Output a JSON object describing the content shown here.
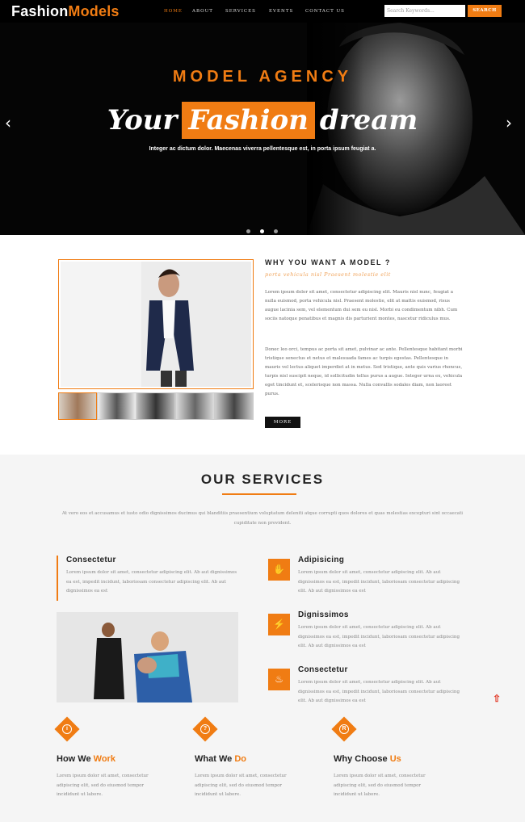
{
  "brand": {
    "part1": "Fashion",
    "part2": "Models"
  },
  "nav": {
    "items": [
      "HOME",
      "ABOUT",
      "SERVICES",
      "EVENTS",
      "CONTACT US"
    ],
    "active_index": 0
  },
  "search": {
    "placeholder": "Search Keywords...",
    "button_label": "SEARCH"
  },
  "hero": {
    "kicker": "MODEL AGENCY",
    "title_left": "Your",
    "title_highlight": "Fashion",
    "title_right": "dream",
    "subtitle": "Integer ac dictum dolor. Maecenas viverra pellentesque est, in porta ipsum feugiat a.",
    "prev_icon": "chevron-left-icon",
    "next_icon": "chevron-right-icon",
    "slides_count": 3,
    "active_slide": 1
  },
  "about": {
    "title": "WHY YOU WANT A MODEL ?",
    "subtitle": "porta vehicula nisl Praesent molestie elit",
    "paragraph1": "Lorem ipsum dolor sit amet, consectetur adipiscing elit. Mauris nisl nunc, feugiat a nulla euismod, porta vehicula nisl. Praesent molestie, elit at mattis euismod, risus augue lacinia sem, vel elementum dui sem eu nisl. Morbi eu condimentum nibh. Cum sociis natoque penatibus et magnis dis parturient montes, nascetur ridiculus mus.",
    "paragraph2": "Donec leo orci, tempus ac porta sit amet, pulvinar ac ante. Pellentesque habitant morbi tristique senectus et netus et malesuada fames ac turpis egestas. Pellentesque in mauris vel lectus aliquet imperdiet at in metus. Sed tristique, ante quis varius rhoncus, turpis nisl suscipit neque, id sollicitudin tellus purus a augue. Integer urna ex, vehicula eget tincidunt et, scelerisque non massa. Nulla convallis sodales diam, non laoreet purus.",
    "more_label": "MORE"
  },
  "services": {
    "title": "OUR SERVICES",
    "intro": "At vero eos et accusamus et iusto odio dignissimos ducimus qui blanditiis praesentium voluptatum deleniti atque corrupti quos dolores et quas molestias excepturi sint occaecati cupiditate non provident.",
    "left_item": {
      "title": "Consectetur",
      "text": "Lorem ipsum dolor sit amet, consectetur adipiscing elit. Ab aut dignissimos ea est, impedit incidunt, laboriosam consectetur adipiscing elit. Ab aut dignissimos ea est"
    },
    "items": [
      {
        "title": "Adipisicing",
        "icon": "thumbs-up-icon",
        "text": "Lorem ipsum dolor sit amet, consectetur adipiscing elit. Ab aut dignissimos ea est, impedit incidunt, laboriosam consectetur adipiscing elit. Ab aut dignissimos ea est"
      },
      {
        "title": "Dignissimos",
        "icon": "bolt-icon",
        "text": "Lorem ipsum dolor sit amet, consectetur adipiscing elit. Ab aut dignissimos ea est, impedit incidunt, laboriosam consectetur adipiscing elit. Ab aut dignissimos ea est"
      },
      {
        "title": "Consectetur",
        "icon": "fire-icon",
        "text": "Lorem ipsum dolor sit amet, consectetur adipiscing elit. Ab aut dignissimos ea est, impedit incidunt, laboriosam consectetur adipiscing elit. Ab aut dignissimos ea est"
      }
    ]
  },
  "features": [
    {
      "title_plain": "How We",
      "title_accent": "Work",
      "icon": "info-icon",
      "glyph": "i",
      "text": "Lorem ipsum dolor sit amet, consectetur adipiscing elit, sed do eiusmod tempor incididunt ut labore."
    },
    {
      "title_plain": "What We",
      "title_accent": "Do",
      "icon": "question-icon",
      "glyph": "?",
      "text": "Lorem ipsum dolor sit amet, consectetur adipiscing elit, sed do eiusmod tempor incididunt ut labore."
    },
    {
      "title_plain": "Why Choose",
      "title_accent": "Us",
      "icon": "registered-icon",
      "glyph": "R",
      "text": "Lorem ipsum dolor sit amet, consectetur adipiscing elit, sed do eiusmod tempor incididunt ut labore."
    }
  ],
  "scroll_top_icon": "arrow-up-icon",
  "colors": {
    "accent": "#f07c13",
    "dark": "#000000"
  }
}
